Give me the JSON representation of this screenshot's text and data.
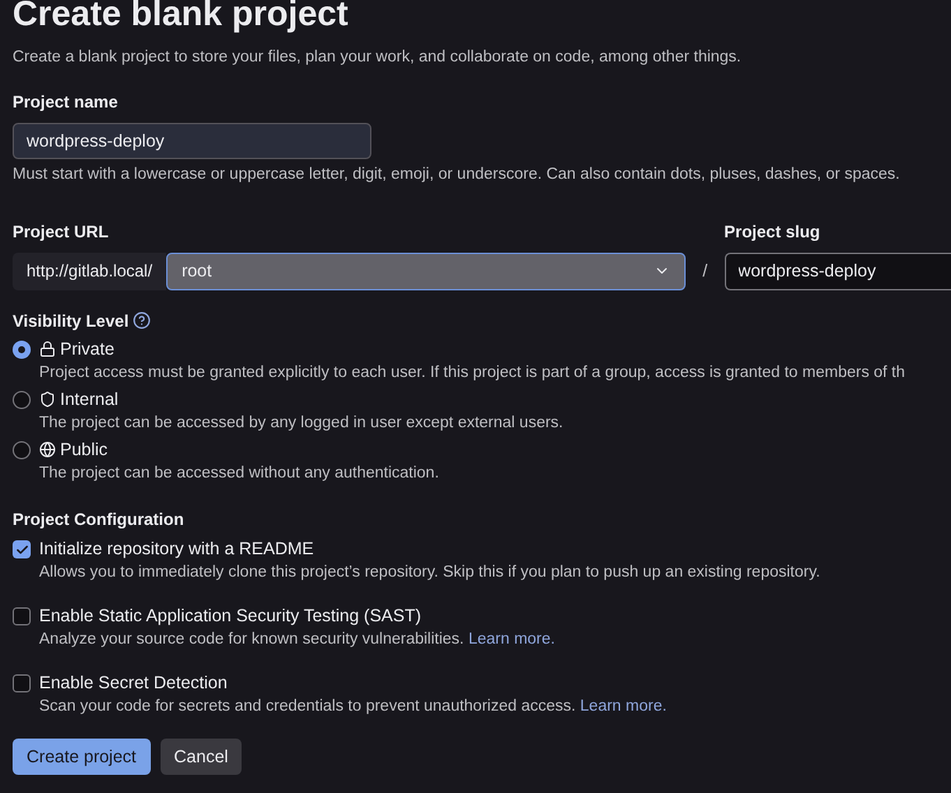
{
  "title": "Create blank project",
  "subtitle": "Create a blank project to store your files, plan your work, and collaborate on code, among other things.",
  "project_name": {
    "label": "Project name",
    "value": "wordpress-deploy",
    "help": "Must start with a lowercase or uppercase letter, digit, emoji, or underscore. Can also contain dots, pluses, dashes, or spaces."
  },
  "project_url": {
    "label": "Project URL",
    "prefix": "http://gitlab.local/",
    "namespace": "root",
    "separator": "/"
  },
  "project_slug": {
    "label": "Project slug",
    "value": "wordpress-deploy"
  },
  "visibility": {
    "label": "Visibility Level",
    "options": [
      {
        "kind": "lock",
        "label": "Private",
        "description": "Project access must be granted explicitly to each user. If this project is part of a group, access is granted to members of th",
        "selected": true
      },
      {
        "kind": "shield",
        "label": "Internal",
        "description": "The project can be accessed by any logged in user except external users.",
        "selected": false
      },
      {
        "kind": "globe",
        "label": "Public",
        "description": "The project can be accessed without any authentication.",
        "selected": false
      }
    ]
  },
  "configuration": {
    "label": "Project Configuration",
    "options": [
      {
        "label": "Initialize repository with a README",
        "description": "Allows you to immediately clone this project’s repository. Skip this if you plan to push up an existing repository.",
        "checked": true
      },
      {
        "label": "Enable Static Application Security Testing (SAST)",
        "description": "Analyze your source code for known security vulnerabilities.",
        "link": "Learn more.",
        "checked": false
      },
      {
        "label": "Enable Secret Detection",
        "description": "Scan your code for secrets and credentials to prevent unauthorized access.",
        "link": "Learn more.",
        "checked": false
      }
    ]
  },
  "buttons": {
    "primary": "Create project",
    "secondary": "Cancel"
  }
}
